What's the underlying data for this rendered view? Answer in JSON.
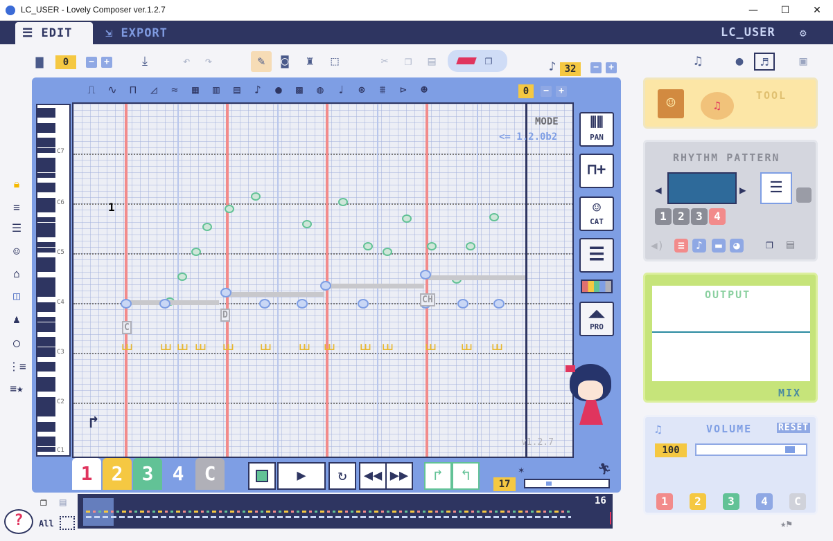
{
  "window": {
    "title": "LC_USER  - Lovely Composer ver.1.2.7",
    "minimize": "—",
    "maximize": "☐",
    "close": "✕"
  },
  "header": {
    "tab_edit": "EDIT",
    "tab_export": "EXPORT",
    "user": "LC_USER"
  },
  "toolbar": {
    "page_number": "0",
    "note_length": "32"
  },
  "instruments": {
    "page_number": "0"
  },
  "editor": {
    "octave_labels": [
      "C7",
      "C6",
      "C5",
      "C4",
      "C3",
      "C2",
      "C1"
    ],
    "measure_number": "1",
    "mode_label": "MODE",
    "mode_value": "<= 1.2.0b2",
    "version": "v1.2.7",
    "side_buttons": [
      "PAN",
      "",
      "CAT",
      "",
      "",
      "PRO"
    ],
    "chord_labels": [
      "C",
      "D",
      "CH"
    ],
    "accent": "#f28b8b",
    "melody_color": "#62c296",
    "rhythm_color": "#e8b830"
  },
  "channels": [
    {
      "label": "1",
      "color": "#ffffff",
      "text": "#e0355e"
    },
    {
      "label": "2",
      "color": "#f5c842",
      "text": "#ffffff"
    },
    {
      "label": "3",
      "color": "#62c296",
      "text": "#ffffff"
    },
    {
      "label": "4",
      "color": "#7e9ee4",
      "text": "#ffffff"
    },
    {
      "label": "C",
      "color": "#b0b0b8",
      "text": "#ffffff"
    }
  ],
  "transport": {
    "position": "17",
    "total": "16",
    "all_label": "All"
  },
  "right": {
    "tool_label": "TOOL",
    "rhythm_title": "RHYTHM PATTERN",
    "rhythm_slots": [
      "1",
      "2",
      "3",
      "4"
    ],
    "output_title": "OUTPUT",
    "output_mode": "MIX",
    "volume_title": "VOLUME",
    "reset_label": "RESET",
    "volume_value": "100",
    "channel_badges": [
      "1",
      "2",
      "3",
      "4",
      "C"
    ]
  }
}
